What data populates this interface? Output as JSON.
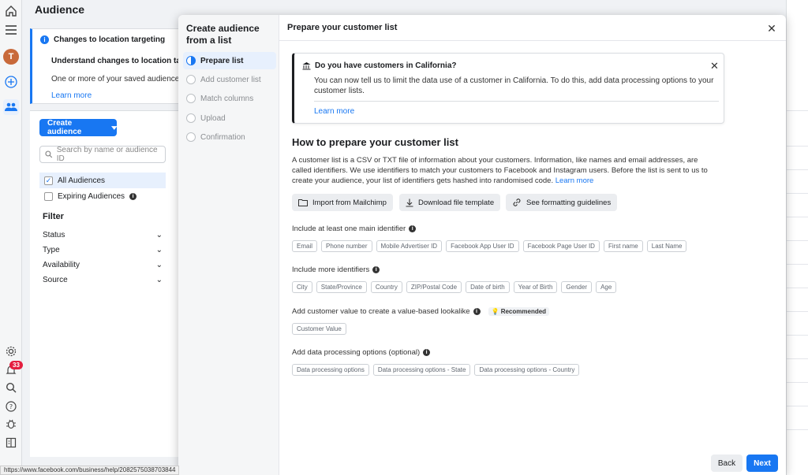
{
  "page": {
    "title": "Audience"
  },
  "rail": {
    "avatar": "T",
    "notifications": "33"
  },
  "notice": {
    "title": "Changes to location targeting",
    "subtitle": "Understand changes to location targeting",
    "desc": "One or more of your saved audiences co",
    "link": "Learn more"
  },
  "sidebar": {
    "create_label": "Create audience",
    "search_placeholder": "Search by name or audience ID",
    "items": [
      {
        "label": "All Audiences",
        "checked": true
      },
      {
        "label": "Expiring Audiences",
        "checked": false
      }
    ],
    "filter_title": "Filter",
    "filters": [
      "Status",
      "Type",
      "Availability",
      "Source"
    ]
  },
  "statusbar": {
    "url": "https://www.facebook.com/business/help/2082575038703844"
  },
  "modal": {
    "steps_title": "Create audience from a list",
    "steps": [
      "Prepare list",
      "Add customer list",
      "Match columns",
      "Upload",
      "Confirmation"
    ],
    "title": "Prepare your customer list",
    "california": {
      "title": "Do you have customers in California?",
      "desc": "You can now tell us to limit the data use of a customer in California. To do this, add data processing options to your customer lists.",
      "link": "Learn more"
    },
    "how_title": "How to prepare your customer list",
    "how_desc": "A customer list is a CSV or TXT file of information about your customers. Information, like names and email addresses, are called identifiers. We use identifiers to match your customers to Facebook and Instagram users. Before the list is sent to us to create your audience, your list of identifiers gets hashed into randomised code.",
    "how_link": "Learn more",
    "buttons": {
      "import": "Import from Mailchimp",
      "download": "Download file template",
      "guidelines": "See formatting guidelines"
    },
    "main_label": "Include at least one main identifier",
    "main_ids": [
      "Email",
      "Phone number",
      "Mobile Advertiser ID",
      "Facebook App User ID",
      "Facebook Page User ID",
      "First name",
      "Last Name"
    ],
    "more_label": "Include more identifiers",
    "more_ids": [
      "City",
      "State/Province",
      "Country",
      "ZIP/Postal Code",
      "Date of birth",
      "Year of Birth",
      "Gender",
      "Age"
    ],
    "value_label": "Add customer value to create a value-based lookalike",
    "recommended": "Recommended",
    "value_ids": [
      "Customer Value"
    ],
    "dpo_label": "Add data processing options (optional)",
    "dpo_ids": [
      "Data processing options",
      "Data processing options - State",
      "Data processing options - Country"
    ],
    "back": "Back",
    "next": "Next"
  }
}
